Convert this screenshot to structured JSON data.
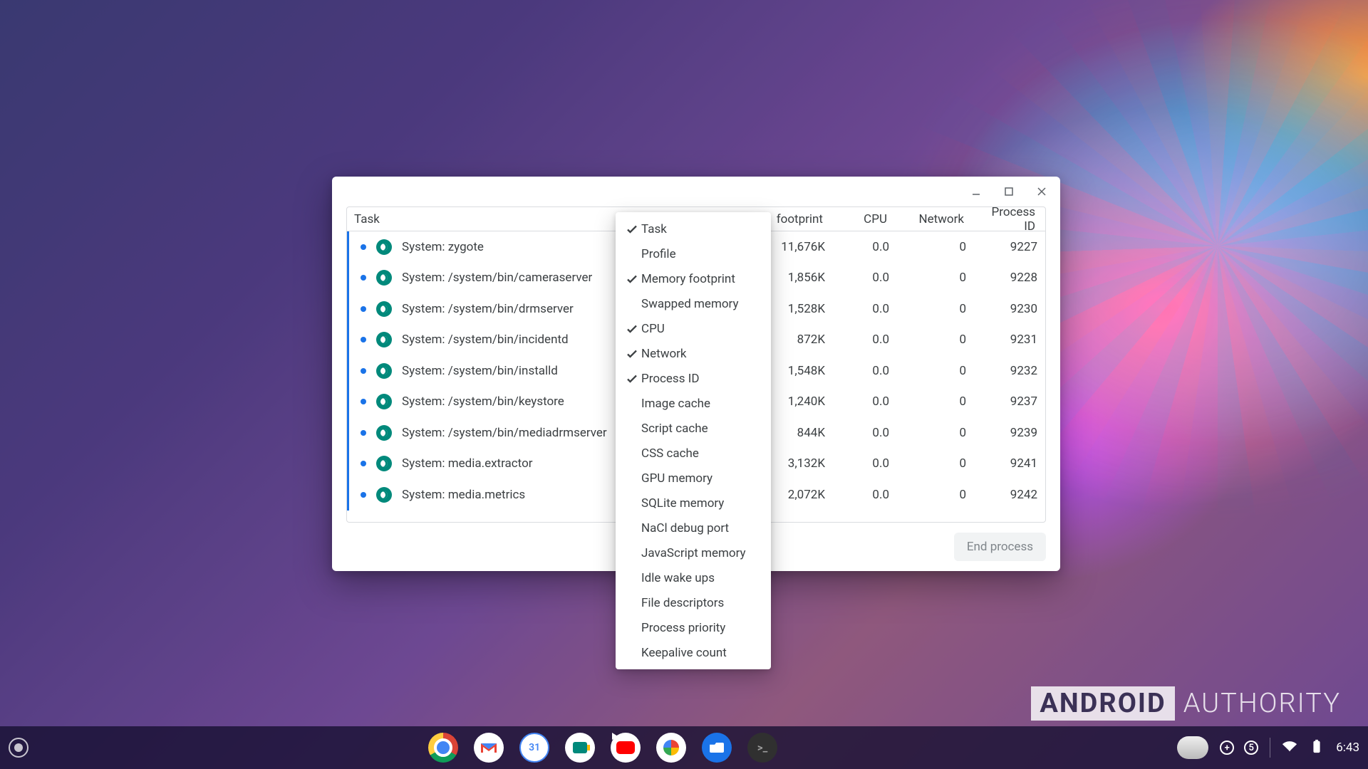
{
  "window": {
    "columns": {
      "task": "Task",
      "memory_suffix": "footprint",
      "cpu": "CPU",
      "network": "Network",
      "pid": "Process ID"
    },
    "rows": [
      {
        "name": "System: zygote",
        "mem": "11,676K",
        "cpu": "0.0",
        "net": "0",
        "pid": "9227"
      },
      {
        "name": "System: /system/bin/cameraserver",
        "mem": "1,856K",
        "cpu": "0.0",
        "net": "0",
        "pid": "9228"
      },
      {
        "name": "System: /system/bin/drmserver",
        "mem": "1,528K",
        "cpu": "0.0",
        "net": "0",
        "pid": "9230"
      },
      {
        "name": "System: /system/bin/incidentd",
        "mem": "872K",
        "cpu": "0.0",
        "net": "0",
        "pid": "9231"
      },
      {
        "name": "System: /system/bin/installd",
        "mem": "1,548K",
        "cpu": "0.0",
        "net": "0",
        "pid": "9232"
      },
      {
        "name": "System: /system/bin/keystore",
        "mem": "1,240K",
        "cpu": "0.0",
        "net": "0",
        "pid": "9237"
      },
      {
        "name": "System: /system/bin/mediadrmserver",
        "mem": "844K",
        "cpu": "0.0",
        "net": "0",
        "pid": "9239"
      },
      {
        "name": "System: media.extractor",
        "mem": "3,132K",
        "cpu": "0.0",
        "net": "0",
        "pid": "9241"
      },
      {
        "name": "System: media.metrics",
        "mem": "2,072K",
        "cpu": "0.0",
        "net": "0",
        "pid": "9242"
      }
    ],
    "end_process_label": "End process"
  },
  "context_menu": {
    "items": [
      {
        "label": "Task",
        "checked": true
      },
      {
        "label": "Profile",
        "checked": false
      },
      {
        "label": "Memory footprint",
        "checked": true
      },
      {
        "label": "Swapped memory",
        "checked": false
      },
      {
        "label": "CPU",
        "checked": true
      },
      {
        "label": "Network",
        "checked": true
      },
      {
        "label": "Process ID",
        "checked": true
      },
      {
        "label": "Image cache",
        "checked": false
      },
      {
        "label": "Script cache",
        "checked": false
      },
      {
        "label": "CSS cache",
        "checked": false
      },
      {
        "label": "GPU memory",
        "checked": false
      },
      {
        "label": "SQLite memory",
        "checked": false
      },
      {
        "label": "NaCl debug port",
        "checked": false
      },
      {
        "label": "JavaScript memory",
        "checked": false
      },
      {
        "label": "Idle wake ups",
        "checked": false
      },
      {
        "label": "File descriptors",
        "checked": false
      },
      {
        "label": "Process priority",
        "checked": false
      },
      {
        "label": "Keepalive count",
        "checked": false
      }
    ]
  },
  "shelf": {
    "apps": [
      {
        "id": "chrome",
        "label": "Google Chrome"
      },
      {
        "id": "gmail",
        "label": "Gmail"
      },
      {
        "id": "calendar",
        "label": "Calendar",
        "badge": "31"
      },
      {
        "id": "meet",
        "label": "Google Meet"
      },
      {
        "id": "youtube",
        "label": "YouTube"
      },
      {
        "id": "photos",
        "label": "Google Photos"
      },
      {
        "id": "files",
        "label": "Files"
      },
      {
        "id": "terminal",
        "label": "Terminal"
      }
    ],
    "status": {
      "notification_plus": "+",
      "notification_count": "5",
      "clock": "6:43"
    }
  },
  "watermark": {
    "brand_boxed": "ANDROID",
    "brand_rest": "AUTHORITY"
  }
}
